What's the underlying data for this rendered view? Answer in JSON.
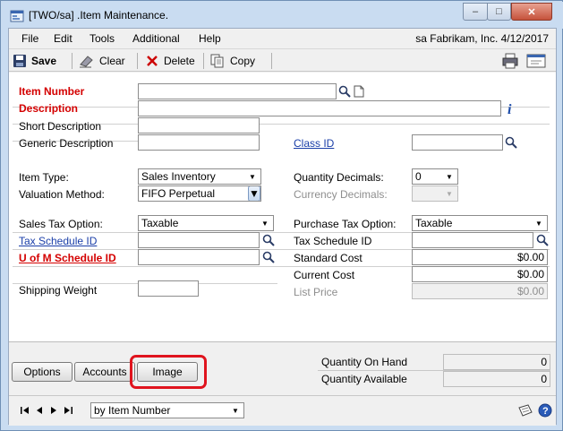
{
  "window": {
    "title": "[TWO/sa] .Item Maintenance.",
    "minimize_glyph": "–",
    "maximize_glyph": "□",
    "close_glyph": "✕"
  },
  "menu": {
    "items": [
      "File",
      "Edit",
      "Tools",
      "Additional",
      "Help"
    ],
    "status": "sa  Fabrikam, Inc.  4/12/2017"
  },
  "toolbar": {
    "save": "Save",
    "clear": "Clear",
    "delete": "Delete",
    "copy": "Copy"
  },
  "fields": {
    "item_number": {
      "label": "Item Number",
      "value": ""
    },
    "description": {
      "label": "Description",
      "value": ""
    },
    "short_description": {
      "label": "Short Description",
      "value": ""
    },
    "generic_description": {
      "label": "Generic Description",
      "value": ""
    },
    "class_id": {
      "label": "Class ID",
      "value": ""
    },
    "item_type": {
      "label": "Item Type:",
      "value": "Sales Inventory"
    },
    "valuation_method": {
      "label": "Valuation Method:",
      "value": "FIFO Perpetual"
    },
    "quantity_decimals": {
      "label": "Quantity Decimals:",
      "value": "0"
    },
    "currency_decimals": {
      "label": "Currency Decimals:",
      "value": ""
    },
    "sales_tax_option": {
      "label": "Sales Tax Option:",
      "value": "Taxable"
    },
    "purchase_tax_option": {
      "label": "Purchase Tax Option:",
      "value": "Taxable"
    },
    "sales_tax_schedule": {
      "label": "Tax Schedule ID",
      "value": ""
    },
    "purchase_tax_schedule": {
      "label": "Tax Schedule ID",
      "value": ""
    },
    "uofm_schedule": {
      "label": "U of M Schedule ID",
      "value": ""
    },
    "standard_cost": {
      "label": "Standard Cost",
      "value": "$0.00"
    },
    "current_cost": {
      "label": "Current Cost",
      "value": "$0.00"
    },
    "list_price": {
      "label": "List Price",
      "value": "$0.00"
    },
    "shipping_weight": {
      "label": "Shipping Weight",
      "value": ""
    }
  },
  "buttons": {
    "options": "Options",
    "accounts": "Accounts",
    "image": "Image"
  },
  "quantities": {
    "on_hand": {
      "label": "Quantity On Hand",
      "value": "0"
    },
    "available": {
      "label": "Quantity Available",
      "value": "0"
    }
  },
  "navigation": {
    "sort_by": "by Item Number"
  },
  "colors": {
    "required_label": "#d40000",
    "link_label": "#1a3ea8",
    "highlight": "#e0141e",
    "title_bar": "#c9dcf1"
  }
}
